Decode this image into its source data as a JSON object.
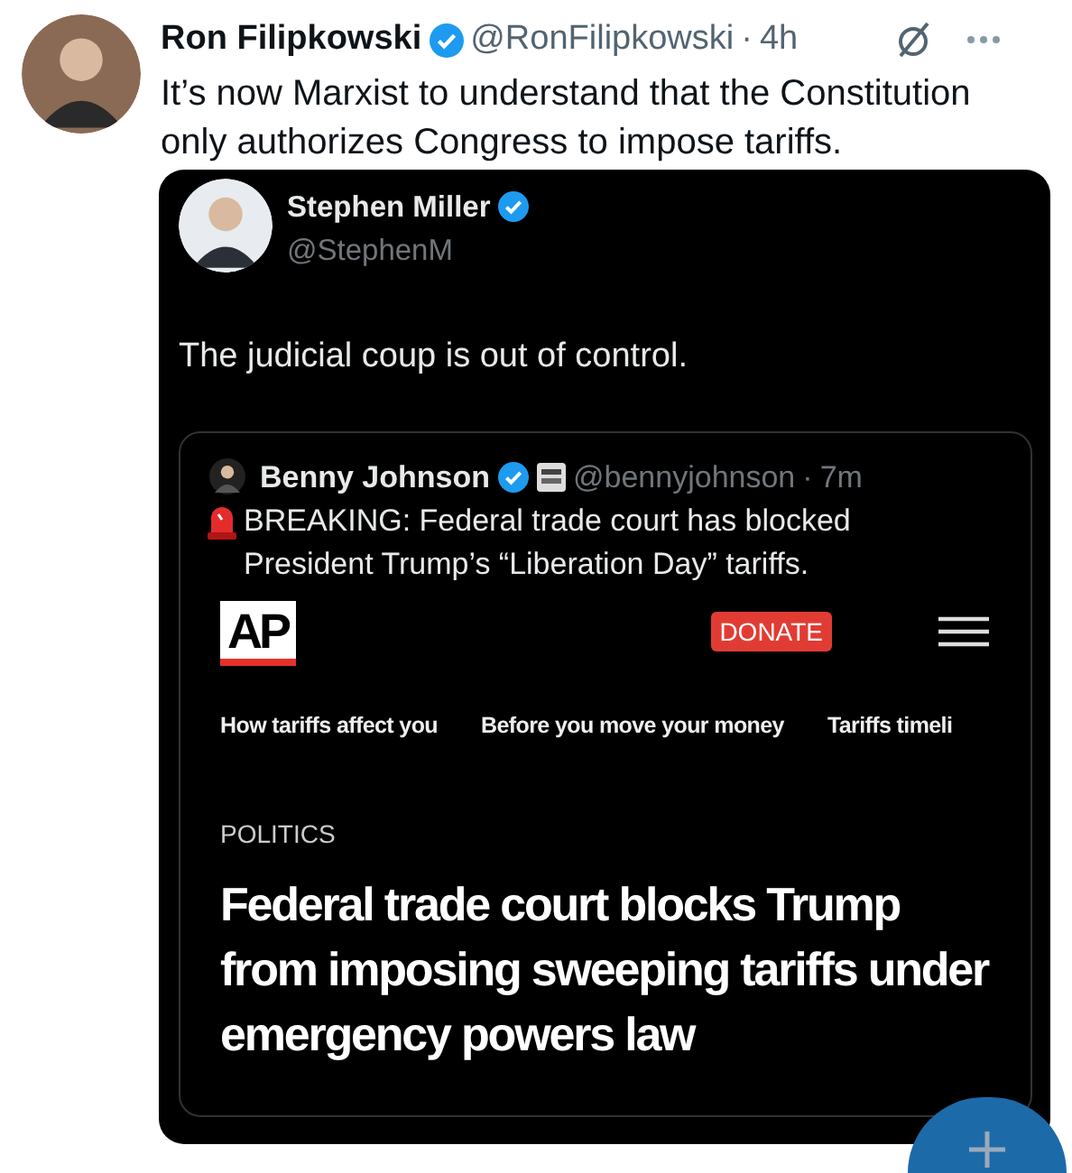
{
  "post": {
    "author": "Ron Filipkowski",
    "verified": true,
    "handle": "@RonFilipkowski",
    "separator": "·",
    "time": "4h",
    "text": "It’s now Marxist to understand that the Constitution only authorizes Congress to impose tariffs."
  },
  "quoted": {
    "author": "Stephen Miller",
    "verified": true,
    "handle": "@StephenM",
    "text": "The judicial coup is out of control.",
    "quoted": {
      "author": "Benny Johnson",
      "verified": true,
      "handle": "@bennyjohnson",
      "separator": "·",
      "time": "7m",
      "text": "BREAKING: Federal trade court has blocked President Trump’s “Liberation Day” tariffs.",
      "article": {
        "logo": "AP",
        "donate": "DONATE",
        "nav_links": [
          "How tariffs affect you",
          "Before you move your money",
          "Tariffs timeli"
        ],
        "section": "POLITICS",
        "headline": "Federal trade court blocks Trump from imposing sweeping tariffs under emergency powers law"
      }
    }
  }
}
